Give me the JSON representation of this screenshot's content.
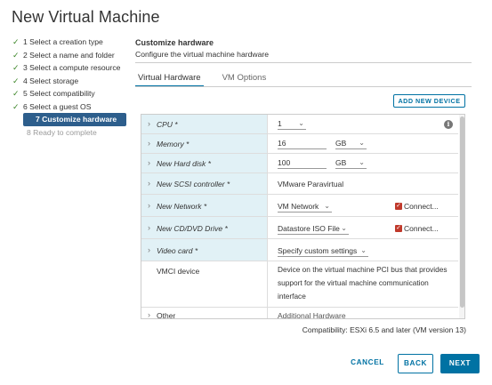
{
  "window": {
    "title": "New Virtual Machine"
  },
  "steps": [
    {
      "label": "1 Select a creation type",
      "state": "done"
    },
    {
      "label": "2 Select a name and folder",
      "state": "done"
    },
    {
      "label": "3 Select a compute resource",
      "state": "done"
    },
    {
      "label": "4 Select storage",
      "state": "done"
    },
    {
      "label": "5 Select compatibility",
      "state": "done"
    },
    {
      "label": "6 Select a guest OS",
      "state": "done"
    },
    {
      "label": "7 Customize hardware",
      "state": "active"
    },
    {
      "label": "8 Ready to complete",
      "state": "pending"
    }
  ],
  "header": {
    "title": "Customize hardware",
    "subtitle": "Configure the virtual machine hardware"
  },
  "tabs": [
    {
      "label": "Virtual Hardware",
      "active": true
    },
    {
      "label": "VM Options",
      "active": false
    }
  ],
  "add_device_label": "ADD NEW DEVICE",
  "hardware": {
    "cpu": {
      "label": "CPU *",
      "value": "1"
    },
    "memory": {
      "label": "Memory *",
      "value": "16",
      "unit": "GB"
    },
    "hard_disk": {
      "label": "New Hard disk *",
      "value": "100",
      "unit": "GB"
    },
    "scsi": {
      "label": "New SCSI controller *",
      "value": "VMware Paravirtual"
    },
    "network": {
      "label": "New Network *",
      "value": "VM Network",
      "connect_label": "Connect..."
    },
    "cd_dvd": {
      "label": "New CD/DVD Drive *",
      "value": "Datastore ISO File",
      "connect_label": "Connect..."
    },
    "video": {
      "label": "Video card *",
      "value": "Specify custom settings"
    },
    "vmci": {
      "label": "VMCI device",
      "description": "Device on the virtual machine PCI bus that provides support for the virtual machine communication interface"
    },
    "other": {
      "label": "Other",
      "value": "Additional Hardware"
    }
  },
  "compatibility": "Compatibility: ESXi 6.5 and later (VM version 13)",
  "buttons": {
    "cancel": "CANCEL",
    "back": "BACK",
    "next": "NEXT"
  },
  "colors": {
    "accent": "#0072a3",
    "active_step": "#2d5e8c",
    "check": "#3c8527",
    "row_label_bg": "#e1f1f6",
    "checkbox": "#c0392b"
  },
  "icons": {
    "done_step": "checkmark-icon",
    "expand": "chevron-right-icon",
    "dropdown": "chevron-down-icon",
    "info": "info-icon"
  }
}
